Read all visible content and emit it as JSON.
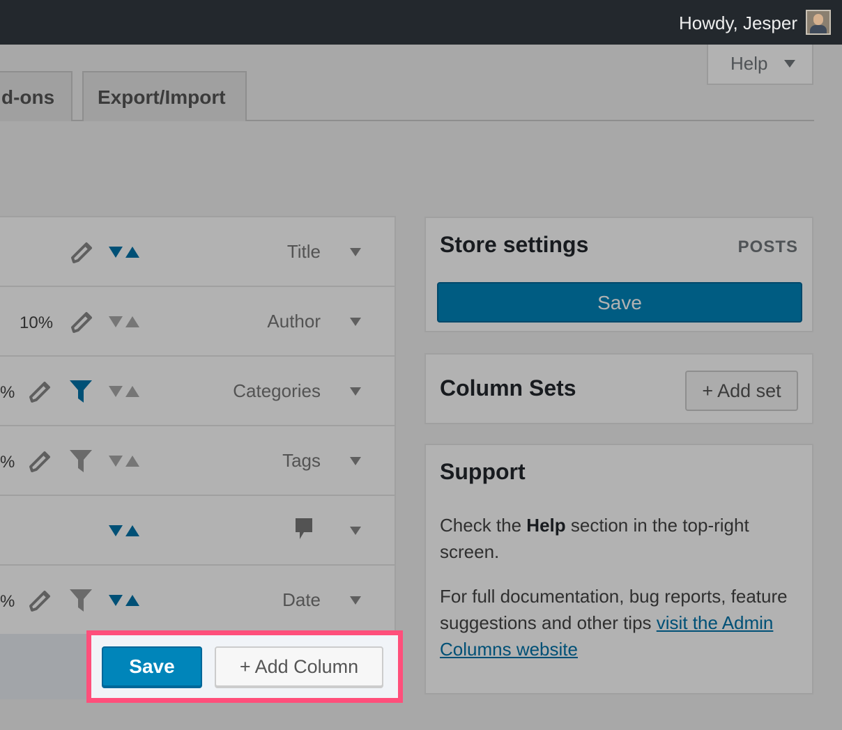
{
  "admin_bar": {
    "greeting": "Howdy, Jesper"
  },
  "help_tab": {
    "label": "Help"
  },
  "nav_tabs": [
    {
      "label": "d-ons"
    },
    {
      "label": "Export/Import"
    }
  ],
  "columns": [
    {
      "label": "Title",
      "width": ""
    },
    {
      "label": "Author",
      "width": "10%"
    },
    {
      "label": "Categories",
      "width": "%"
    },
    {
      "label": "Tags",
      "width": "%"
    },
    {
      "label": "",
      "width": ""
    },
    {
      "label": "Date",
      "width": "%"
    }
  ],
  "actions": {
    "save_label": "Save",
    "add_column_label": "+ Add Column"
  },
  "store_settings": {
    "title": "Store settings",
    "post_type": "POSTS",
    "save_label": "Save"
  },
  "column_sets": {
    "title": "Column Sets",
    "add_set_label": "+ Add set"
  },
  "support": {
    "title": "Support",
    "p1_before": "Check the ",
    "p1_bold": "Help",
    "p1_after": " section in the top-right screen.",
    "p2_before": "For full documentation, bug reports, feature suggestions and other tips ",
    "p2_link": "visit the Admin Columns website"
  },
  "colors": {
    "accent": "#0085ba",
    "highlight": "#ff4f7b",
    "admin_bar": "#23282d"
  },
  "icons": [
    "pencil-icon",
    "sort-icon",
    "filter-icon",
    "comment-icon",
    "dropdown-caret-icon"
  ]
}
